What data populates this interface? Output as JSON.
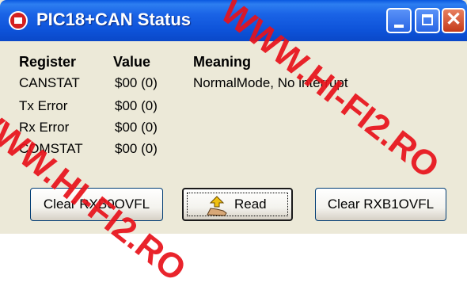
{
  "window": {
    "title": "PIC18+CAN Status"
  },
  "headers": {
    "register": "Register",
    "value": "Value",
    "meaning": "Meaning"
  },
  "rows": [
    {
      "register": "CANSTAT",
      "value": "$00 (0)",
      "meaning": "NormalMode, No interrupt"
    },
    {
      "register": "Tx Error",
      "value": "$00 (0)",
      "meaning": ""
    },
    {
      "register": "Rx Error",
      "value": "$00 (0)",
      "meaning": ""
    },
    {
      "register": "COMSTAT",
      "value": "$00 (0)",
      "meaning": ""
    }
  ],
  "buttons": {
    "clear_rxb0": "Clear RXB0OVFL",
    "read": "Read",
    "clear_rxb1": "Clear RXB1OVFL"
  },
  "watermark": {
    "text": "WWW.HI-FI2.RO",
    "color": "#e8121b"
  },
  "icons": {
    "app": "chip-icon",
    "read": "read-hand-icon"
  }
}
